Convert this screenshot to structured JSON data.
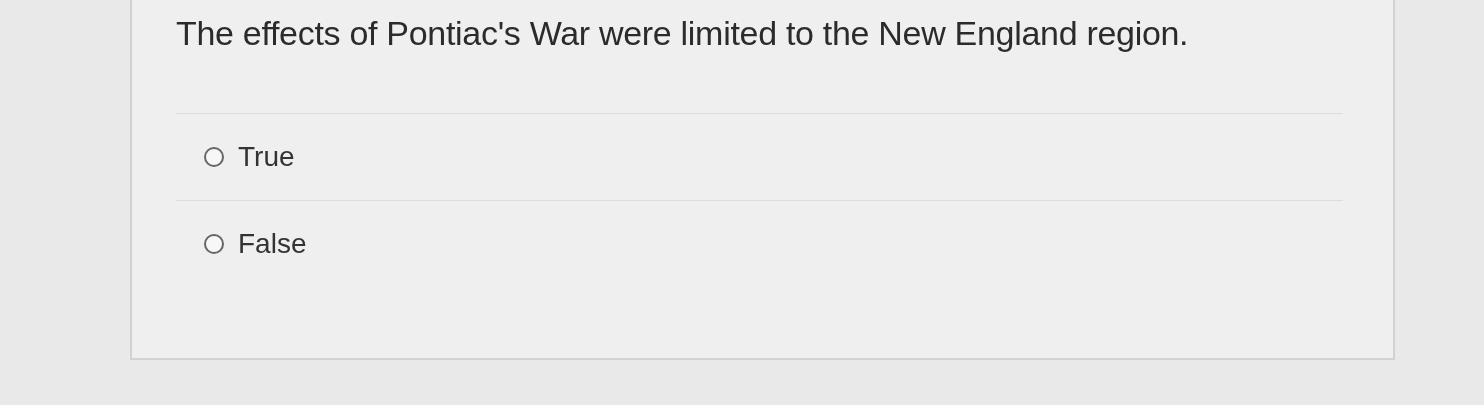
{
  "question": {
    "text": "The effects of Pontiac's War were limited to the New England region.",
    "options": [
      {
        "label": "True",
        "selected": false
      },
      {
        "label": "False",
        "selected": false
      }
    ]
  }
}
